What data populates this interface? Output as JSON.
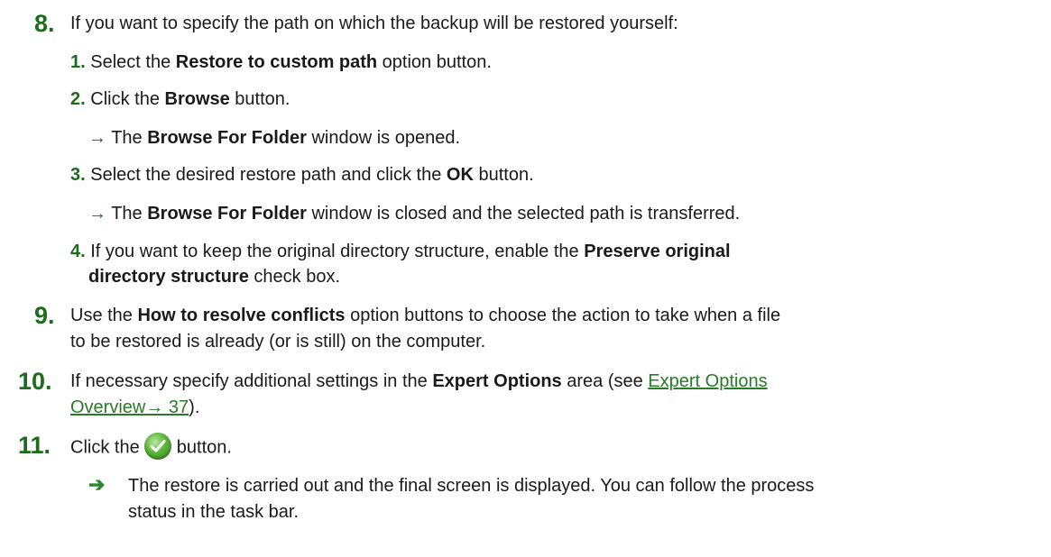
{
  "steps": {
    "s8": {
      "num": "8.",
      "text": "If you want to specify the path on which the backup will be restored yourself:",
      "sub1": {
        "num": "1.",
        "pre": "Select the ",
        "bold": "Restore to custom path",
        "post": " option button."
      },
      "sub2": {
        "num": "2.",
        "pre": "Click the ",
        "bold": "Browse",
        "post": " button."
      },
      "sub2_result": {
        "arrow": "→",
        "pre": " The ",
        "bold": "Browse For Folder",
        "post": " window is opened."
      },
      "sub3": {
        "num": "3.",
        "pre": "Select the desired restore path and click the ",
        "bold": "OK",
        "post": " button."
      },
      "sub3_result": {
        "arrow": "→",
        "pre": " The ",
        "bold": "Browse For Folder",
        "post": " window is closed and the selected path is transferred."
      },
      "sub4": {
        "num": "4.",
        "pre": "If you want to keep the original directory structure, enable the ",
        "bold1": "Preserve original",
        "bold2": "directory structure",
        "post": " check box."
      }
    },
    "s9": {
      "num": "9.",
      "pre": "Use the ",
      "bold": "How to resolve conflicts",
      "post": " option buttons to choose the action to take when a file",
      "line2": "to be restored is already (or is still) on the computer."
    },
    "s10": {
      "num": "10.",
      "pre": "If necessary specify additional settings in the ",
      "bold": "Expert Options",
      "mid": " area (see ",
      "link1": "Expert Options",
      "link2": "Overview→ 37",
      "post": ")."
    },
    "s11": {
      "num": "11.",
      "pre": "Click the ",
      "post": " button.",
      "result_arrow": "➔",
      "result_line1": "The restore is carried out and the final screen is displayed. You can follow the process",
      "result_line2": "status in the task bar."
    }
  },
  "colors": {
    "accent_green": "#1d6b1d",
    "link_green": "#2a7a2a"
  },
  "icons": {
    "confirm": "green-checkmark-icon"
  }
}
